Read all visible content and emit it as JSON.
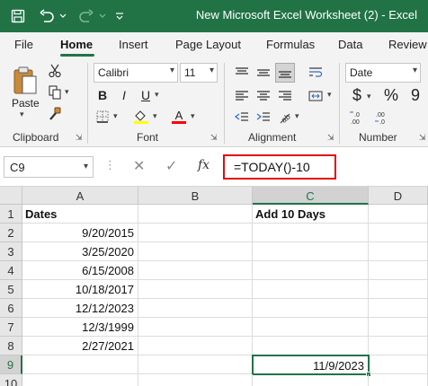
{
  "window": {
    "title": "New Microsoft Excel Worksheet (2)  -  Excel"
  },
  "tabs": [
    {
      "label": "File"
    },
    {
      "label": "Home"
    },
    {
      "label": "Insert"
    },
    {
      "label": "Page Layout"
    },
    {
      "label": "Formulas"
    },
    {
      "label": "Data"
    },
    {
      "label": "Review"
    }
  ],
  "ribbon": {
    "clipboard": {
      "paste_label": "Paste",
      "group_label": "Clipboard"
    },
    "font": {
      "font_name": "Calibri",
      "font_size": "11",
      "group_label": "Font",
      "highlight_color": "#ffff00",
      "font_color": "#ff0000"
    },
    "alignment": {
      "group_label": "Alignment"
    },
    "number": {
      "format": "Date",
      "currency_symbol": "$",
      "percent_symbol": "%",
      "comma_symbol": "9",
      "group_label": "Number"
    }
  },
  "formula_bar": {
    "name_box": "C9",
    "fx_label": "fx",
    "formula": "=TODAY()-10"
  },
  "sheet": {
    "columns": [
      "A",
      "B",
      "C",
      "D"
    ],
    "rows": [
      "1",
      "2",
      "3",
      "4",
      "5",
      "6",
      "7",
      "8",
      "9",
      "10"
    ],
    "cells": {
      "A1": "Dates",
      "C1": "Add 10 Days",
      "A2": "9/20/2015",
      "A3": "3/25/2020",
      "A4": "6/15/2008",
      "A5": "10/18/2017",
      "A6": "12/12/2023",
      "A7": "12/3/1999",
      "A8": "2/27/2021",
      "C9": "11/9/2023"
    },
    "active_cell": "C9"
  },
  "colors": {
    "accent": "#217346",
    "formula_highlight": "#e00b0b"
  }
}
